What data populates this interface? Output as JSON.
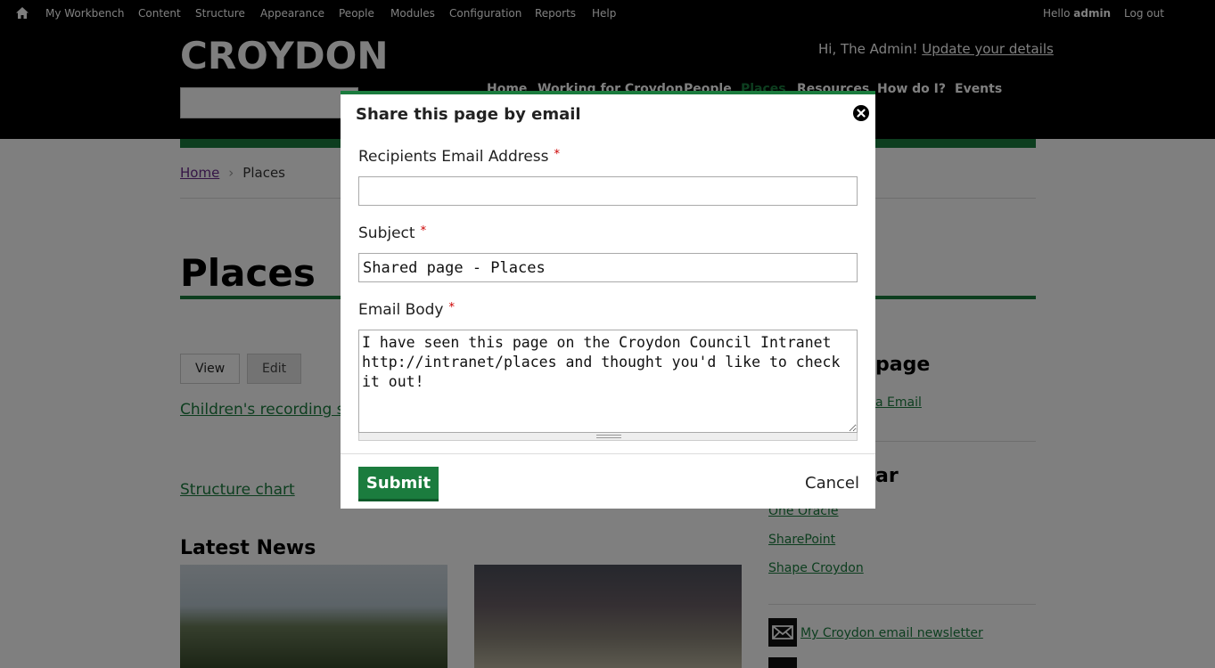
{
  "toolbar": {
    "home_icon": "home-icon",
    "items": [
      "My Workbench",
      "Content",
      "Structure",
      "Appearance",
      "People",
      "Modules",
      "Configuration",
      "Reports",
      "Help"
    ],
    "hello_prefix": "Hello",
    "hello_user": "admin",
    "logout": "Log out"
  },
  "header": {
    "logo": "CROYDON",
    "greeting": "Hi, The Admin!",
    "update_link": "Update your details",
    "nav": [
      "Home",
      "Working for Croydon",
      "People",
      "Places",
      "Resources",
      "How do I?",
      "Events"
    ],
    "active_nav": "Places",
    "accent_color": "#1b7c3e"
  },
  "breadcrumb": {
    "home": "Home",
    "separator": "›",
    "current": "Places"
  },
  "page": {
    "title": "Places",
    "tabs": [
      "View",
      "Edit"
    ],
    "links": [
      "Children's recording s",
      "Structure chart"
    ],
    "latest_news": "Latest News"
  },
  "sidebar": {
    "share_heading": "page",
    "share_link": "a Email",
    "popular_heading": "ar",
    "popular_links": [
      "One Oracle",
      "SharePoint",
      "Shape Croydon"
    ],
    "newsletter": "My Croydon email newsletter"
  },
  "modal": {
    "title": "Share this page by email",
    "close_icon": "close-icon",
    "recipients_label": "Recipients Email Address",
    "recipients_value": "",
    "subject_label": "Subject",
    "subject_value": "Shared page - Places",
    "body_label": "Email Body",
    "body_value": "I have seen this page on the Croydon Council Intranet\nhttp://intranet/places and thought you'd like to check it out!",
    "required_marker": "*",
    "submit": "Submit",
    "cancel": "Cancel"
  }
}
